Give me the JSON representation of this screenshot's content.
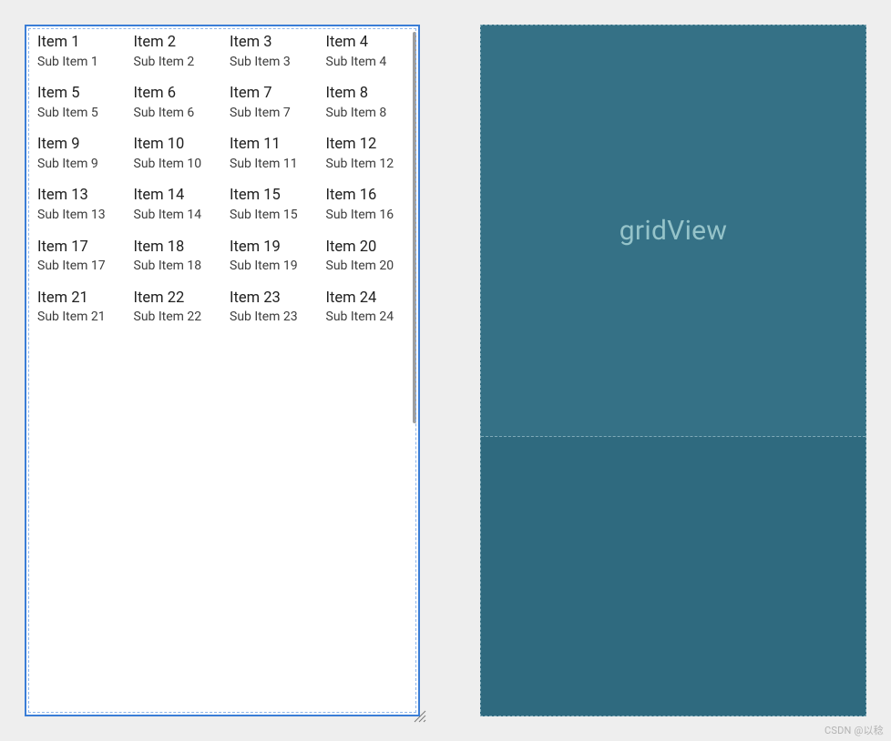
{
  "design": {
    "grid": {
      "columns": 4,
      "items": [
        {
          "title": "Item 1",
          "sub": "Sub Item 1"
        },
        {
          "title": "Item 2",
          "sub": "Sub Item 2"
        },
        {
          "title": "Item 3",
          "sub": "Sub Item 3"
        },
        {
          "title": "Item 4",
          "sub": "Sub Item 4"
        },
        {
          "title": "Item 5",
          "sub": "Sub Item 5"
        },
        {
          "title": "Item 6",
          "sub": "Sub Item 6"
        },
        {
          "title": "Item 7",
          "sub": "Sub Item 7"
        },
        {
          "title": "Item 8",
          "sub": "Sub Item 8"
        },
        {
          "title": "Item 9",
          "sub": "Sub Item 9"
        },
        {
          "title": "Item 10",
          "sub": "Sub Item 10"
        },
        {
          "title": "Item 11",
          "sub": "Sub Item 11"
        },
        {
          "title": "Item 12",
          "sub": "Sub Item 12"
        },
        {
          "title": "Item 13",
          "sub": "Sub Item 13"
        },
        {
          "title": "Item 14",
          "sub": "Sub Item 14"
        },
        {
          "title": "Item 15",
          "sub": "Sub Item 15"
        },
        {
          "title": "Item 16",
          "sub": "Sub Item 16"
        },
        {
          "title": "Item 17",
          "sub": "Sub Item 17"
        },
        {
          "title": "Item 18",
          "sub": "Sub Item 18"
        },
        {
          "title": "Item 19",
          "sub": "Sub Item 19"
        },
        {
          "title": "Item 20",
          "sub": "Sub Item 20"
        },
        {
          "title": "Item 21",
          "sub": "Sub Item 21"
        },
        {
          "title": "Item 22",
          "sub": "Sub Item 22"
        },
        {
          "title": "Item 23",
          "sub": "Sub Item 23"
        },
        {
          "title": "Item 24",
          "sub": "Sub Item 24"
        }
      ]
    }
  },
  "blueprint": {
    "widget_label": "gridView"
  },
  "watermark": "CSDN @以稔"
}
